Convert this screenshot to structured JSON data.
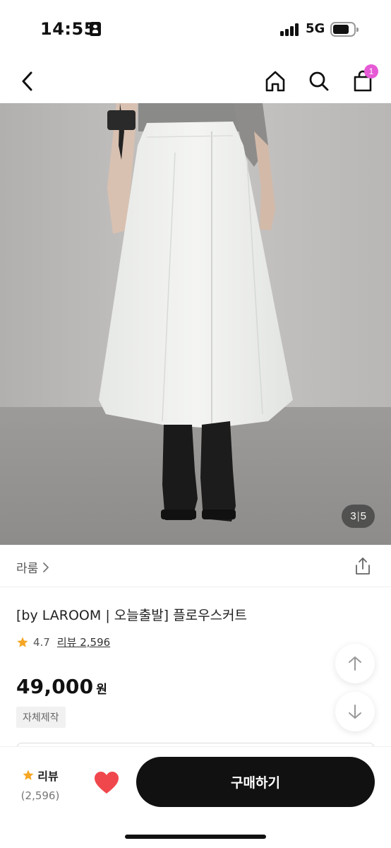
{
  "status_bar": {
    "time": "14:55",
    "network": "5G"
  },
  "nav": {
    "cart_count": "1"
  },
  "gallery": {
    "current": "3",
    "separator": "|",
    "total": "5"
  },
  "seller": {
    "name": "라룸"
  },
  "product": {
    "title": "[by LAROOM | 오늘출발] 플로우스커트",
    "rating": "4.7",
    "review_label": "리뷰 2,596",
    "price": "49,000",
    "currency": "원",
    "tag": "자체제작"
  },
  "bottom_bar": {
    "review_label": "리뷰",
    "review_count": "(2,596)",
    "buy_label": "구매하기"
  },
  "colors": {
    "accent_star": "#f5a623",
    "heart": "#f0474d",
    "cart_badge": "#e65ad6",
    "buy_button": "#111111"
  }
}
